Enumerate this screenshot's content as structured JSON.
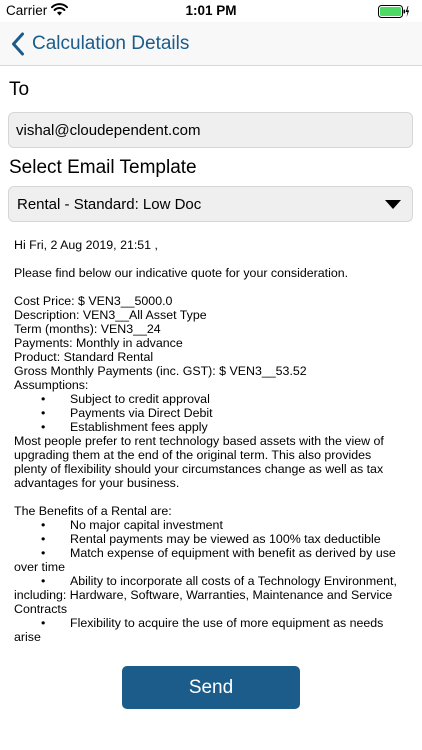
{
  "status_bar": {
    "carrier": "Carrier",
    "time": "1:01 PM"
  },
  "nav": {
    "back_label": "Calculation Details"
  },
  "form": {
    "to_label": "To",
    "to_value": "vishal@cloudependent.com",
    "template_label": "Select Email Template",
    "template_value": "Rental - Standard: Low Doc"
  },
  "message": {
    "greeting": "Hi Fri, 2 Aug 2019, 21:51 ,",
    "intro": "Please find below our indicative quote for your consideration.",
    "cost_price": "Cost Price: $ VEN3__5000.0",
    "description": "Description:  VEN3__All Asset Type",
    "term": "Term (months):  VEN3__24",
    "payments": "Payments: Monthly in advance",
    "product": "Product: Standard Rental",
    "gross": "Gross Monthly Payments (inc. GST): $ VEN3__53.52",
    "assumptions_label": "Assumptions:",
    "assumptions": [
      "Subject to credit approval",
      "Payments via Direct Debit",
      "Establishment fees apply"
    ],
    "rent_paragraph": "Most people prefer to rent technology based assets with the view of upgrading them at the end of the original term. This also provides plenty of flexibility should your circumstances change as well as tax advantages for your business.",
    "benefits_label": "The Benefits of a Rental are:",
    "benefits": [
      "No major capital investment",
      "Rental payments may be viewed as 100% tax deductible",
      "Match expense of equipment with benefit as derived by use over time",
      "Ability to incorporate all costs of a Technology Environment, including: Hardware, Software, Warranties, Maintenance and Service Contracts",
      "Flexibility to acquire the use of more equipment as needs arise"
    ]
  },
  "actions": {
    "send_label": "Send"
  },
  "colors": {
    "accent": "#1b5c8a",
    "field_bg": "#efefef",
    "battery": "#4cd964"
  },
  "icons": {
    "wifi": "wifi-icon",
    "battery": "battery-icon",
    "back": "chevron-left-icon",
    "dropdown": "caret-down-icon"
  }
}
